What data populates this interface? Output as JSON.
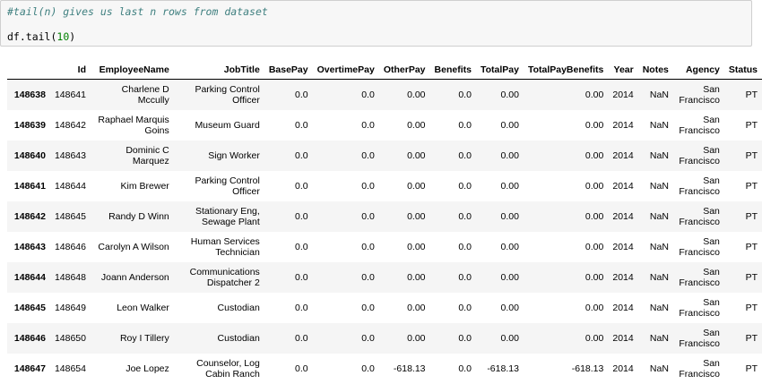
{
  "code_cell": {
    "comment": "#tail(n) gives us last n rows from dataset",
    "stmt_prefix": "df.tail(",
    "stmt_arg": "10",
    "stmt_suffix": ")"
  },
  "table": {
    "columns": [
      "Id",
      "EmployeeName",
      "JobTitle",
      "BasePay",
      "OvertimePay",
      "OtherPay",
      "Benefits",
      "TotalPay",
      "TotalPayBenefits",
      "Year",
      "Notes",
      "Agency",
      "Status"
    ],
    "rows": [
      {
        "index": "148638",
        "cells": [
          "148641",
          "Charlene D Mccully",
          "Parking Control Officer",
          "0.0",
          "0.0",
          "0.00",
          "0.0",
          "0.00",
          "0.00",
          "2014",
          "NaN",
          "San Francisco",
          "PT"
        ]
      },
      {
        "index": "148639",
        "cells": [
          "148642",
          "Raphael Marquis Goins",
          "Museum Guard",
          "0.0",
          "0.0",
          "0.00",
          "0.0",
          "0.00",
          "0.00",
          "2014",
          "NaN",
          "San Francisco",
          "PT"
        ]
      },
      {
        "index": "148640",
        "cells": [
          "148643",
          "Dominic C Marquez",
          "Sign Worker",
          "0.0",
          "0.0",
          "0.00",
          "0.0",
          "0.00",
          "0.00",
          "2014",
          "NaN",
          "San Francisco",
          "PT"
        ]
      },
      {
        "index": "148641",
        "cells": [
          "148644",
          "Kim Brewer",
          "Parking Control Officer",
          "0.0",
          "0.0",
          "0.00",
          "0.0",
          "0.00",
          "0.00",
          "2014",
          "NaN",
          "San Francisco",
          "PT"
        ]
      },
      {
        "index": "148642",
        "cells": [
          "148645",
          "Randy D Winn",
          "Stationary Eng, Sewage Plant",
          "0.0",
          "0.0",
          "0.00",
          "0.0",
          "0.00",
          "0.00",
          "2014",
          "NaN",
          "San Francisco",
          "PT"
        ]
      },
      {
        "index": "148643",
        "cells": [
          "148646",
          "Carolyn A Wilson",
          "Human Services Technician",
          "0.0",
          "0.0",
          "0.00",
          "0.0",
          "0.00",
          "0.00",
          "2014",
          "NaN",
          "San Francisco",
          "PT"
        ]
      },
      {
        "index": "148644",
        "cells": [
          "148648",
          "Joann Anderson",
          "Communications Dispatcher 2",
          "0.0",
          "0.0",
          "0.00",
          "0.0",
          "0.00",
          "0.00",
          "2014",
          "NaN",
          "San Francisco",
          "PT"
        ]
      },
      {
        "index": "148645",
        "cells": [
          "148649",
          "Leon Walker",
          "Custodian",
          "0.0",
          "0.0",
          "0.00",
          "0.0",
          "0.00",
          "0.00",
          "2014",
          "NaN",
          "San Francisco",
          "PT"
        ]
      },
      {
        "index": "148646",
        "cells": [
          "148650",
          "Roy I Tillery",
          "Custodian",
          "0.0",
          "0.0",
          "0.00",
          "0.0",
          "0.00",
          "0.00",
          "2014",
          "NaN",
          "San Francisco",
          "PT"
        ]
      },
      {
        "index": "148647",
        "cells": [
          "148654",
          "Joe Lopez",
          "Counselor, Log Cabin Ranch",
          "0.0",
          "0.0",
          "-618.13",
          "0.0",
          "-618.13",
          "-618.13",
          "2014",
          "NaN",
          "San Francisco",
          "PT"
        ]
      }
    ]
  }
}
